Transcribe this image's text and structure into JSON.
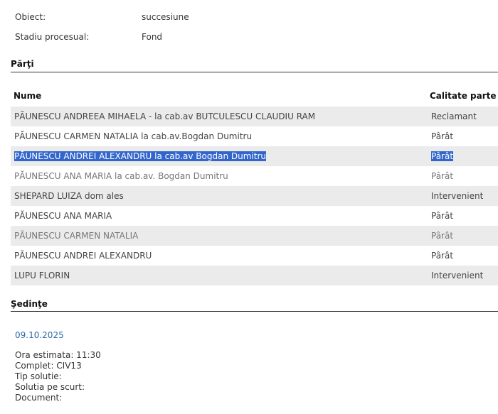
{
  "info": [
    {
      "label": "Obiect:",
      "value": "succesiune"
    },
    {
      "label": "Stadiu procesual:",
      "value": "Fond"
    }
  ],
  "parti": {
    "title": "Părţi",
    "headers": {
      "name": "Nume",
      "role": "Calitate parte"
    },
    "rows": [
      {
        "name": "PĂUNESCU ANDREEA MIHAELA - la cab.av BUTCULESCU CLAUDIU RAM",
        "role": "Reclamant"
      },
      {
        "name": "PĂUNESCU CARMEN NATALIA la cab.av.Bogdan Dumitru",
        "role": "Pârât"
      },
      {
        "name": "PĂUNESCU ANDREI ALEXANDRU la cab.av Bogdan Dumitru",
        "role": "Pârât"
      },
      {
        "name": "PĂUNESCU ANA MARIA la cab.av. Bogdan Dumitru",
        "role": "Pârât"
      },
      {
        "name": "SHEPARD LUIZA dom ales",
        "role": "Intervenient"
      },
      {
        "name": "PĂUNESCU ANA MARIA",
        "role": "Pârât"
      },
      {
        "name": "PĂUNESCU CARMEN NATALIA",
        "role": "Pârât"
      },
      {
        "name": "PĂUNESCU ANDREI ALEXANDRU",
        "role": "Pârât"
      },
      {
        "name": "LUPU FLORIN",
        "role": "Intervenient"
      }
    ]
  },
  "sedinte": {
    "title": "Şedinţe",
    "date": "09.10.2025",
    "lines": [
      "Ora estimata: 11:30",
      "Complet: CIV13",
      "Tip solutie:",
      "Solutia pe scurt:",
      "Document:"
    ]
  }
}
